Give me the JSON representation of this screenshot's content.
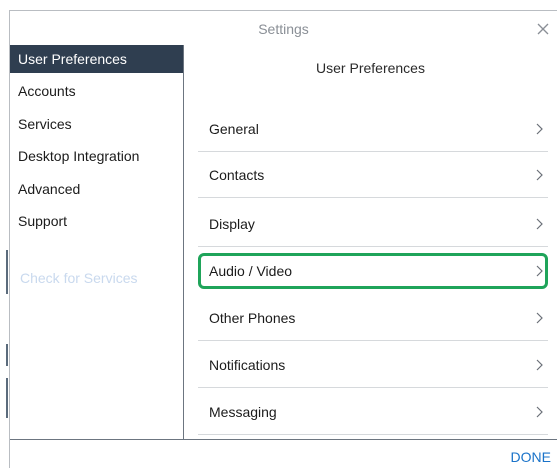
{
  "window": {
    "title": "Settings"
  },
  "sidebar": {
    "items": [
      {
        "label": "User Preferences",
        "active": true
      },
      {
        "label": "Accounts",
        "active": false
      },
      {
        "label": "Services",
        "active": false
      },
      {
        "label": "Desktop Integration",
        "active": false
      },
      {
        "label": "Advanced",
        "active": false
      },
      {
        "label": "Support",
        "active": false
      }
    ],
    "check_services_label": "Check for Services"
  },
  "content": {
    "header": "User Preferences",
    "rows": [
      {
        "label": "General"
      },
      {
        "label": "Contacts"
      },
      {
        "label": "Display"
      },
      {
        "label": "Audio / Video",
        "highlighted": true
      },
      {
        "label": "Other Phones"
      },
      {
        "label": "Notifications"
      },
      {
        "label": "Messaging"
      }
    ]
  },
  "footer": {
    "done_label": "DONE"
  },
  "colors": {
    "sidebar_active_bg": "#2f3e50",
    "highlight_border": "#1fa45a",
    "link_blue": "#1a73c9",
    "disabled_link": "#c9d9ee"
  },
  "icons": {
    "close": "close-icon",
    "chevron": "chevron-right-icon"
  }
}
